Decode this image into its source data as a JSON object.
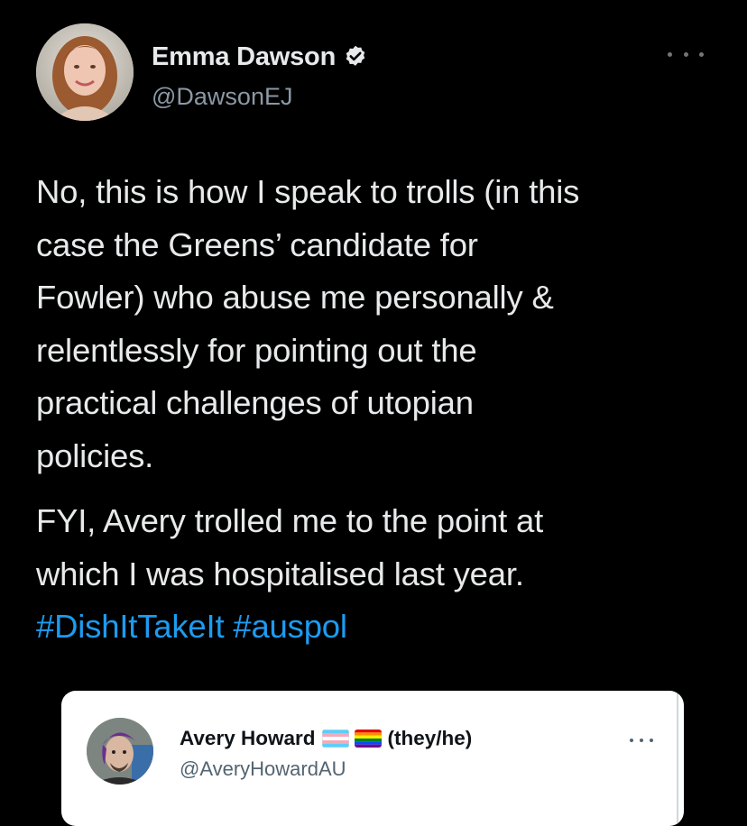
{
  "tweet": {
    "author": {
      "name": "Emma Dawson",
      "handle": "@DawsonEJ",
      "verified": true
    },
    "paragraphs": [
      "No, this is how I speak to trolls (in this\ncase the Greens’ candidate for\nFowler) who abuse me personally &\nrelentlessly for pointing out the\npractical challenges of utopian\npolicies.",
      "FYI, Avery trolled me to the point at\nwhich I was hospitalised last year."
    ],
    "hashtags": [
      "#DishItTakeIt",
      "#auspol"
    ],
    "hashtag_color": "#1d9bf0"
  },
  "quoted_tweet": {
    "author": {
      "name": "Avery Howard",
      "flags": [
        "transgender-flag",
        "rainbow-flag"
      ],
      "pronouns": "(they/he)",
      "handle": "@AveryHowardAU"
    }
  },
  "icons": {
    "more": "more-horizontal-icon",
    "verified": "verified-badge-icon"
  }
}
